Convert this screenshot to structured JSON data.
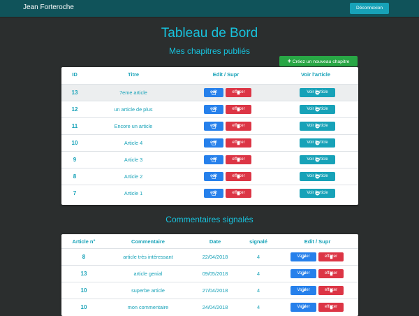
{
  "navbar": {
    "brand": "Jean Forteroche",
    "logout_label": "Déconnexion"
  },
  "page": {
    "title": "Tableau de Bord",
    "chapters_heading": "Mes chapitres publiés",
    "create_label": "Créez un nouveau chapitre",
    "comments_heading": "Commentaires signalés"
  },
  "chapters": {
    "headers": {
      "id": "ID",
      "title": "Titre",
      "edit": "Edit / Supr",
      "view": "Voir l'article"
    },
    "rows": [
      {
        "id": "13",
        "title": "7eme article"
      },
      {
        "id": "12",
        "title": "un article de plus"
      },
      {
        "id": "11",
        "title": "Encore un article"
      },
      {
        "id": "10",
        "title": "Article 4"
      },
      {
        "id": "9",
        "title": "Article 3"
      },
      {
        "id": "8",
        "title": "Article 2"
      },
      {
        "id": "7",
        "title": "Article 1"
      }
    ],
    "edit_label": "edit",
    "delete_label": "effacer",
    "view_label": "Voir l'article"
  },
  "comments": {
    "headers": {
      "article": "Article n°",
      "comment": "Commentaire",
      "date": "Date",
      "flagged": "signalé",
      "edit": "Edit / Supr"
    },
    "rows": [
      {
        "article": "8",
        "comment": "article très intéressant",
        "date": "22/04/2018",
        "flagged": "4"
      },
      {
        "article": "13",
        "comment": "article genial",
        "date": "09/05/2018",
        "flagged": "4"
      },
      {
        "article": "10",
        "comment": "superbe article",
        "date": "27/04/2018",
        "flagged": "4"
      },
      {
        "article": "10",
        "comment": "mon commentaire",
        "date": "24/04/2018",
        "flagged": "4"
      }
    ],
    "validate_label": "Valider",
    "delete_label": "effacer"
  },
  "colors": {
    "navbar": "#10535a",
    "background": "#2b2e2e",
    "accent": "#17a2b8",
    "primary": "#2680eb",
    "danger": "#dc3545",
    "success": "#28a745"
  },
  "icons": {
    "create": "plus-icon",
    "edit": "edit-icon",
    "delete": "trash-icon",
    "view": "arrow-circle-icon",
    "validate": "check-icon"
  }
}
